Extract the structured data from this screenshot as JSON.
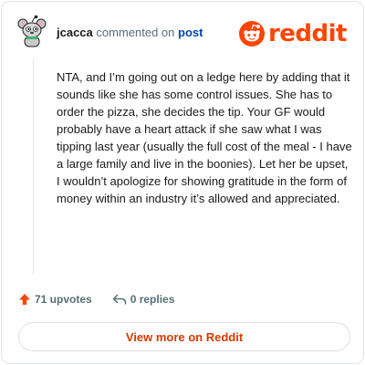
{
  "header": {
    "username": "jcacca",
    "action_text": "commented on",
    "target": "post",
    "logo_text": "reddit"
  },
  "comment": {
    "body": "NTA, and I’m going out on a ledge here by adding that it sounds like she has some control issues. She has to order the pizza, she decides the tip. Your GF would probably have a heart attack if she saw what I was tipping last year (usually the full cost of the meal - I have a large family and live in the boonies). Let her be upset, I wouldn’t apologize for showing gratitude in the form of money within an industry it’s allowed and appreciated."
  },
  "actions": {
    "upvotes": "71 upvotes",
    "replies": "0 replies"
  },
  "footer": {
    "view_more_label": "View more on Reddit"
  },
  "colors": {
    "brand": "#ff4500",
    "link": "#0045ac",
    "button_text": "#d93900"
  },
  "icons": {
    "avatar": "snoo-avatar-icon",
    "logo": "reddit-snoo-icon",
    "upvote": "upvote-arrow-icon",
    "reply": "reply-arrow-icon"
  }
}
